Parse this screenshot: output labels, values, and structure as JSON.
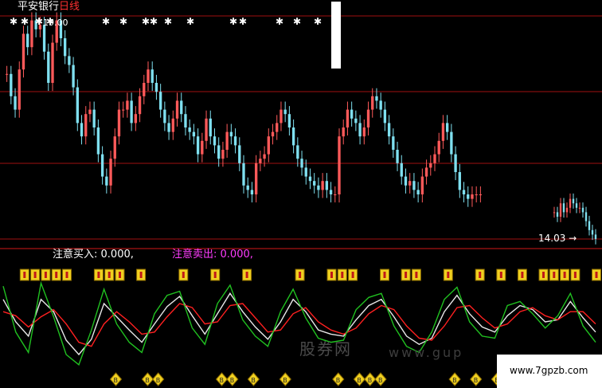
{
  "title": {
    "stock": "平安银行",
    "period": "日线"
  },
  "price_high_label": "19.00",
  "price_low_label": "14.03",
  "indicator": {
    "buy_label": "注意买入:",
    "buy_value": "0.000,",
    "sell_label": "注意卖出:",
    "sell_value": "0.000,"
  },
  "signal_glyph": "B",
  "watermark": {
    "cn": "股券网",
    "en": "www.gup"
  },
  "site_url": "www.7gpzb.com",
  "colors": {
    "up": "#ff5a5a",
    "down": "#7fe0f0",
    "grid": "#a01010",
    "k_line": "#e8e8e8",
    "d_line": "#ff2020",
    "j_line": "#20c020",
    "signal": "#f0d020",
    "sell_text": "#ff3cff"
  },
  "chart_data": [
    {
      "type": "candlestick",
      "title": "平安银行 日线",
      "ylabels": {
        "high": "19.00",
        "low": "14.03"
      },
      "closes": [
        17.7,
        17.2,
        16.9,
        17.8,
        18.6,
        18.3,
        18.9,
        18.7,
        18.8,
        18.2,
        17.5,
        18.4,
        18.9,
        18.5,
        18.1,
        17.9,
        17.4,
        16.6,
        16.3,
        16.8,
        16.9,
        16.5,
        15.9,
        15.4,
        15.2,
        15.8,
        16.3,
        16.9,
        16.9,
        17.1,
        16.6,
        16.8,
        17.2,
        17.5,
        17.8,
        17.5,
        17.3,
        16.9,
        16.6,
        16.4,
        16.7,
        17.1,
        16.8,
        16.5,
        16.4,
        16.3,
        15.9,
        16.2,
        16.7,
        16.3,
        16.1,
        15.8,
        16.0,
        16.4,
        16.3,
        16.1,
        15.7,
        15.2,
        15.1,
        15.0,
        15.7,
        15.8,
        15.9,
        16.3,
        16.4,
        16.6,
        16.9,
        16.8,
        16.5,
        16.1,
        15.8,
        15.6,
        15.4,
        15.3,
        15.2,
        15.1,
        15.3,
        15.1,
        15.0,
        15.0,
        16.3,
        16.5,
        16.9,
        16.7,
        16.6,
        16.3,
        16.5,
        16.9,
        17.2,
        17.1,
        16.9,
        16.6,
        16.3,
        16.0,
        15.7,
        15.4,
        15.2,
        15.3,
        15.1,
        15.0,
        15.4,
        15.6,
        15.7,
        15.9,
        16.2,
        16.6,
        16.4,
        15.9,
        15.5,
        15.1,
        15.0,
        14.9,
        15.0,
        15.0,
        15.0
      ],
      "tail_closes": [
        14.6,
        14.5,
        14.8,
        14.6,
        14.7,
        14.9,
        14.8,
        14.7,
        14.7,
        14.6,
        14.4,
        14.2,
        14.1,
        14.0
      ]
    },
    {
      "type": "line",
      "series": [
        {
          "name": "",
          "color": "k_line",
          "values": [
            0.72,
            0.5,
            0.36,
            0.72,
            0.6,
            0.32,
            0.18,
            0.33,
            0.68,
            0.55,
            0.42,
            0.3,
            0.48,
            0.65,
            0.75,
            0.56,
            0.38,
            0.58,
            0.78,
            0.6,
            0.45,
            0.33,
            0.5,
            0.72,
            0.6,
            0.42,
            0.38,
            0.36,
            0.52,
            0.66,
            0.72,
            0.55,
            0.36,
            0.28,
            0.34,
            0.6,
            0.76,
            0.58,
            0.45,
            0.4,
            0.56,
            0.66,
            0.62,
            0.5,
            0.52,
            0.7,
            0.54,
            0.4
          ]
        },
        {
          "name": "",
          "color": "d_line",
          "values": [
            0.6,
            0.56,
            0.45,
            0.55,
            0.62,
            0.48,
            0.3,
            0.26,
            0.48,
            0.6,
            0.5,
            0.38,
            0.4,
            0.55,
            0.68,
            0.64,
            0.48,
            0.5,
            0.66,
            0.68,
            0.54,
            0.4,
            0.42,
            0.58,
            0.64,
            0.5,
            0.42,
            0.38,
            0.44,
            0.58,
            0.66,
            0.62,
            0.46,
            0.34,
            0.32,
            0.46,
            0.64,
            0.66,
            0.54,
            0.44,
            0.48,
            0.6,
            0.64,
            0.56,
            0.52,
            0.6,
            0.6,
            0.48
          ]
        },
        {
          "name": "",
          "color": "j_line",
          "values": [
            0.85,
            0.4,
            0.2,
            0.88,
            0.55,
            0.18,
            0.08,
            0.42,
            0.82,
            0.48,
            0.3,
            0.2,
            0.58,
            0.76,
            0.8,
            0.44,
            0.28,
            0.68,
            0.86,
            0.52,
            0.36,
            0.26,
            0.6,
            0.82,
            0.54,
            0.34,
            0.3,
            0.32,
            0.62,
            0.74,
            0.78,
            0.46,
            0.26,
            0.2,
            0.4,
            0.72,
            0.84,
            0.5,
            0.36,
            0.34,
            0.66,
            0.7,
            0.58,
            0.44,
            0.56,
            0.78,
            0.46,
            0.3
          ]
        }
      ],
      "buy_signal_slots": [
        1,
        2,
        3,
        4,
        5,
        8,
        9,
        10,
        12,
        16,
        19,
        22,
        27,
        30,
        31,
        32,
        35,
        37,
        38,
        41,
        44,
        46,
        48,
        50,
        51,
        52,
        53,
        55
      ],
      "sell_signal_slots": [
        5,
        8,
        9,
        15,
        16,
        18,
        21,
        26,
        28,
        29,
        30,
        37,
        39,
        41,
        42,
        43
      ]
    }
  ]
}
